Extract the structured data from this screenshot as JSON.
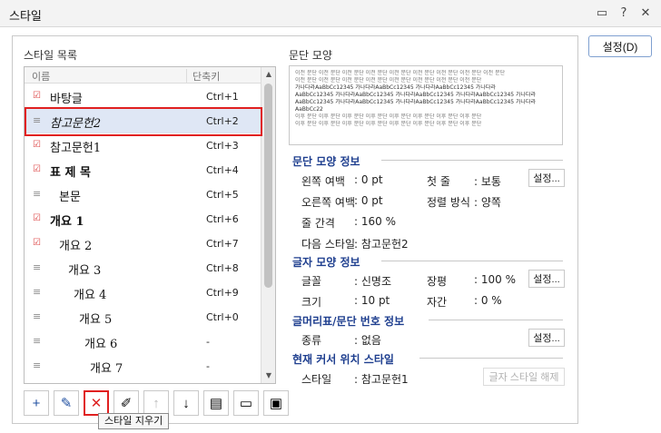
{
  "window": {
    "title": "스타일"
  },
  "titlebar_icons": [
    "comment-icon",
    "help-icon",
    "close-icon"
  ],
  "settings_button": "설정(D)",
  "list": {
    "title": "스타일 목록",
    "col_name": "이름",
    "col_key": "단축키",
    "rows": [
      {
        "name": "바탕글",
        "key": "Ctrl+1",
        "icon": "check",
        "indent": 0,
        "style": "normal"
      },
      {
        "name": "참고문헌2",
        "key": "Ctrl+2",
        "icon": "lines",
        "indent": 0,
        "style": "italic",
        "selected": true
      },
      {
        "name": "참고문헌1",
        "key": "Ctrl+3",
        "icon": "check",
        "indent": 0,
        "style": "normal"
      },
      {
        "name": "표 제 목",
        "key": "Ctrl+4",
        "icon": "check",
        "indent": 0,
        "style": "bold"
      },
      {
        "name": "본문",
        "key": "Ctrl+5",
        "icon": "lines",
        "indent": 10,
        "style": "normal"
      },
      {
        "name": "개요 1",
        "key": "Ctrl+6",
        "icon": "check",
        "indent": 0,
        "style": "bold"
      },
      {
        "name": "개요 2",
        "key": "Ctrl+7",
        "icon": "check",
        "indent": 10,
        "style": "normal"
      },
      {
        "name": "개요 3",
        "key": "Ctrl+8",
        "icon": "lines",
        "indent": 20,
        "style": "normal"
      },
      {
        "name": "개요 4",
        "key": "Ctrl+9",
        "icon": "lines",
        "indent": 26,
        "style": "normal"
      },
      {
        "name": "개요 5",
        "key": "Ctrl+0",
        "icon": "lines",
        "indent": 32,
        "style": "normal"
      },
      {
        "name": "개요 6",
        "key": "-",
        "icon": "lines",
        "indent": 38,
        "style": "normal"
      },
      {
        "name": "개요 7",
        "key": "-",
        "icon": "lines",
        "indent": 44,
        "style": "normal"
      }
    ]
  },
  "toolbar": {
    "buttons": [
      {
        "name": "add-style-button",
        "glyph": "+"
      },
      {
        "name": "edit-style-button",
        "glyph": "✎"
      },
      {
        "name": "delete-style-button",
        "glyph": "✕"
      },
      {
        "name": "edit-all-button",
        "glyph": "✐"
      },
      {
        "name": "move-up-button",
        "glyph": "↑"
      },
      {
        "name": "move-down-button",
        "glyph": "↓"
      },
      {
        "name": "import-button",
        "glyph": "▤"
      },
      {
        "name": "open-folder-button",
        "glyph": "▭"
      },
      {
        "name": "save-button",
        "glyph": "▣"
      }
    ],
    "tooltip": "스타일 지우기"
  },
  "preview": {
    "title": "문단 모양",
    "lines_before": [
      "이전 문단 이전 문단 이전 문단 이전 문단 이전 문단 이전 문단 이전 문단 이전 문단 이전 문단",
      "이전 문단 이전 문단 이전 문단 이전 문단 이전 문단 이전 문단 이전 문단 이전 문단"
    ],
    "lines_current": [
      "가나다라AaBbCc12345   가나다라AaBbCc12345   가나다라AaBbCc12345   가나다라",
      "AaBbCc12345 가나다라AaBbCc12345 가나다라AaBbCc12345 가나다라AaBbCc12345 가나다라",
      "AaBbCc12345 가나다라AaBbCc12345 가나다라AaBbCc12345 가나다라AaBbCc12345 가나다라",
      "AaBbCc22"
    ],
    "lines_after": [
      "이후 문단 이후 문단 이후 문단 이후 문단 이후 문단 이후 문단 이후 문단 이후 문단",
      "이후 문단 이후 문단 이후 문단 이후 문단 이후 문단 이후 문단 이후 문단 이후 문단"
    ]
  },
  "para_info": {
    "title": "문단 모양 정보",
    "left_margin_label": "왼쪽 여백",
    "left_margin_value": ": 0 pt",
    "right_margin_label": "오른쪽 여백",
    "right_margin_value": ": 0 pt",
    "line_spacing_label": "줄 간격",
    "line_spacing_value": ": 160 %",
    "next_style_label": "다음 스타일",
    "next_style_value": ": 참고문헌2",
    "first_line_label": "첫 줄",
    "first_line_value": ": 보통",
    "align_label": "정렬 방식",
    "align_value": ": 양쪽",
    "button": "설정..."
  },
  "char_info": {
    "title": "글자 모양 정보",
    "font_label": "글꼴",
    "font_value": ": 신명조",
    "size_label": "크기",
    "size_value": ": 10 pt",
    "ratio_label": "장평",
    "ratio_value": ": 100 %",
    "spacing_label": "자간",
    "spacing_value": ": 0 %",
    "button": "설정..."
  },
  "numbering_info": {
    "title": "글머리표/문단 번호 정보",
    "kind_label": "종류",
    "kind_value": ": 없음",
    "button": "설정..."
  },
  "cursor_info": {
    "title": "현재 커서 위치 스타일",
    "style_label": "스타일",
    "style_value": ": 참고문헌1",
    "button": "글자 스타일 해제"
  }
}
